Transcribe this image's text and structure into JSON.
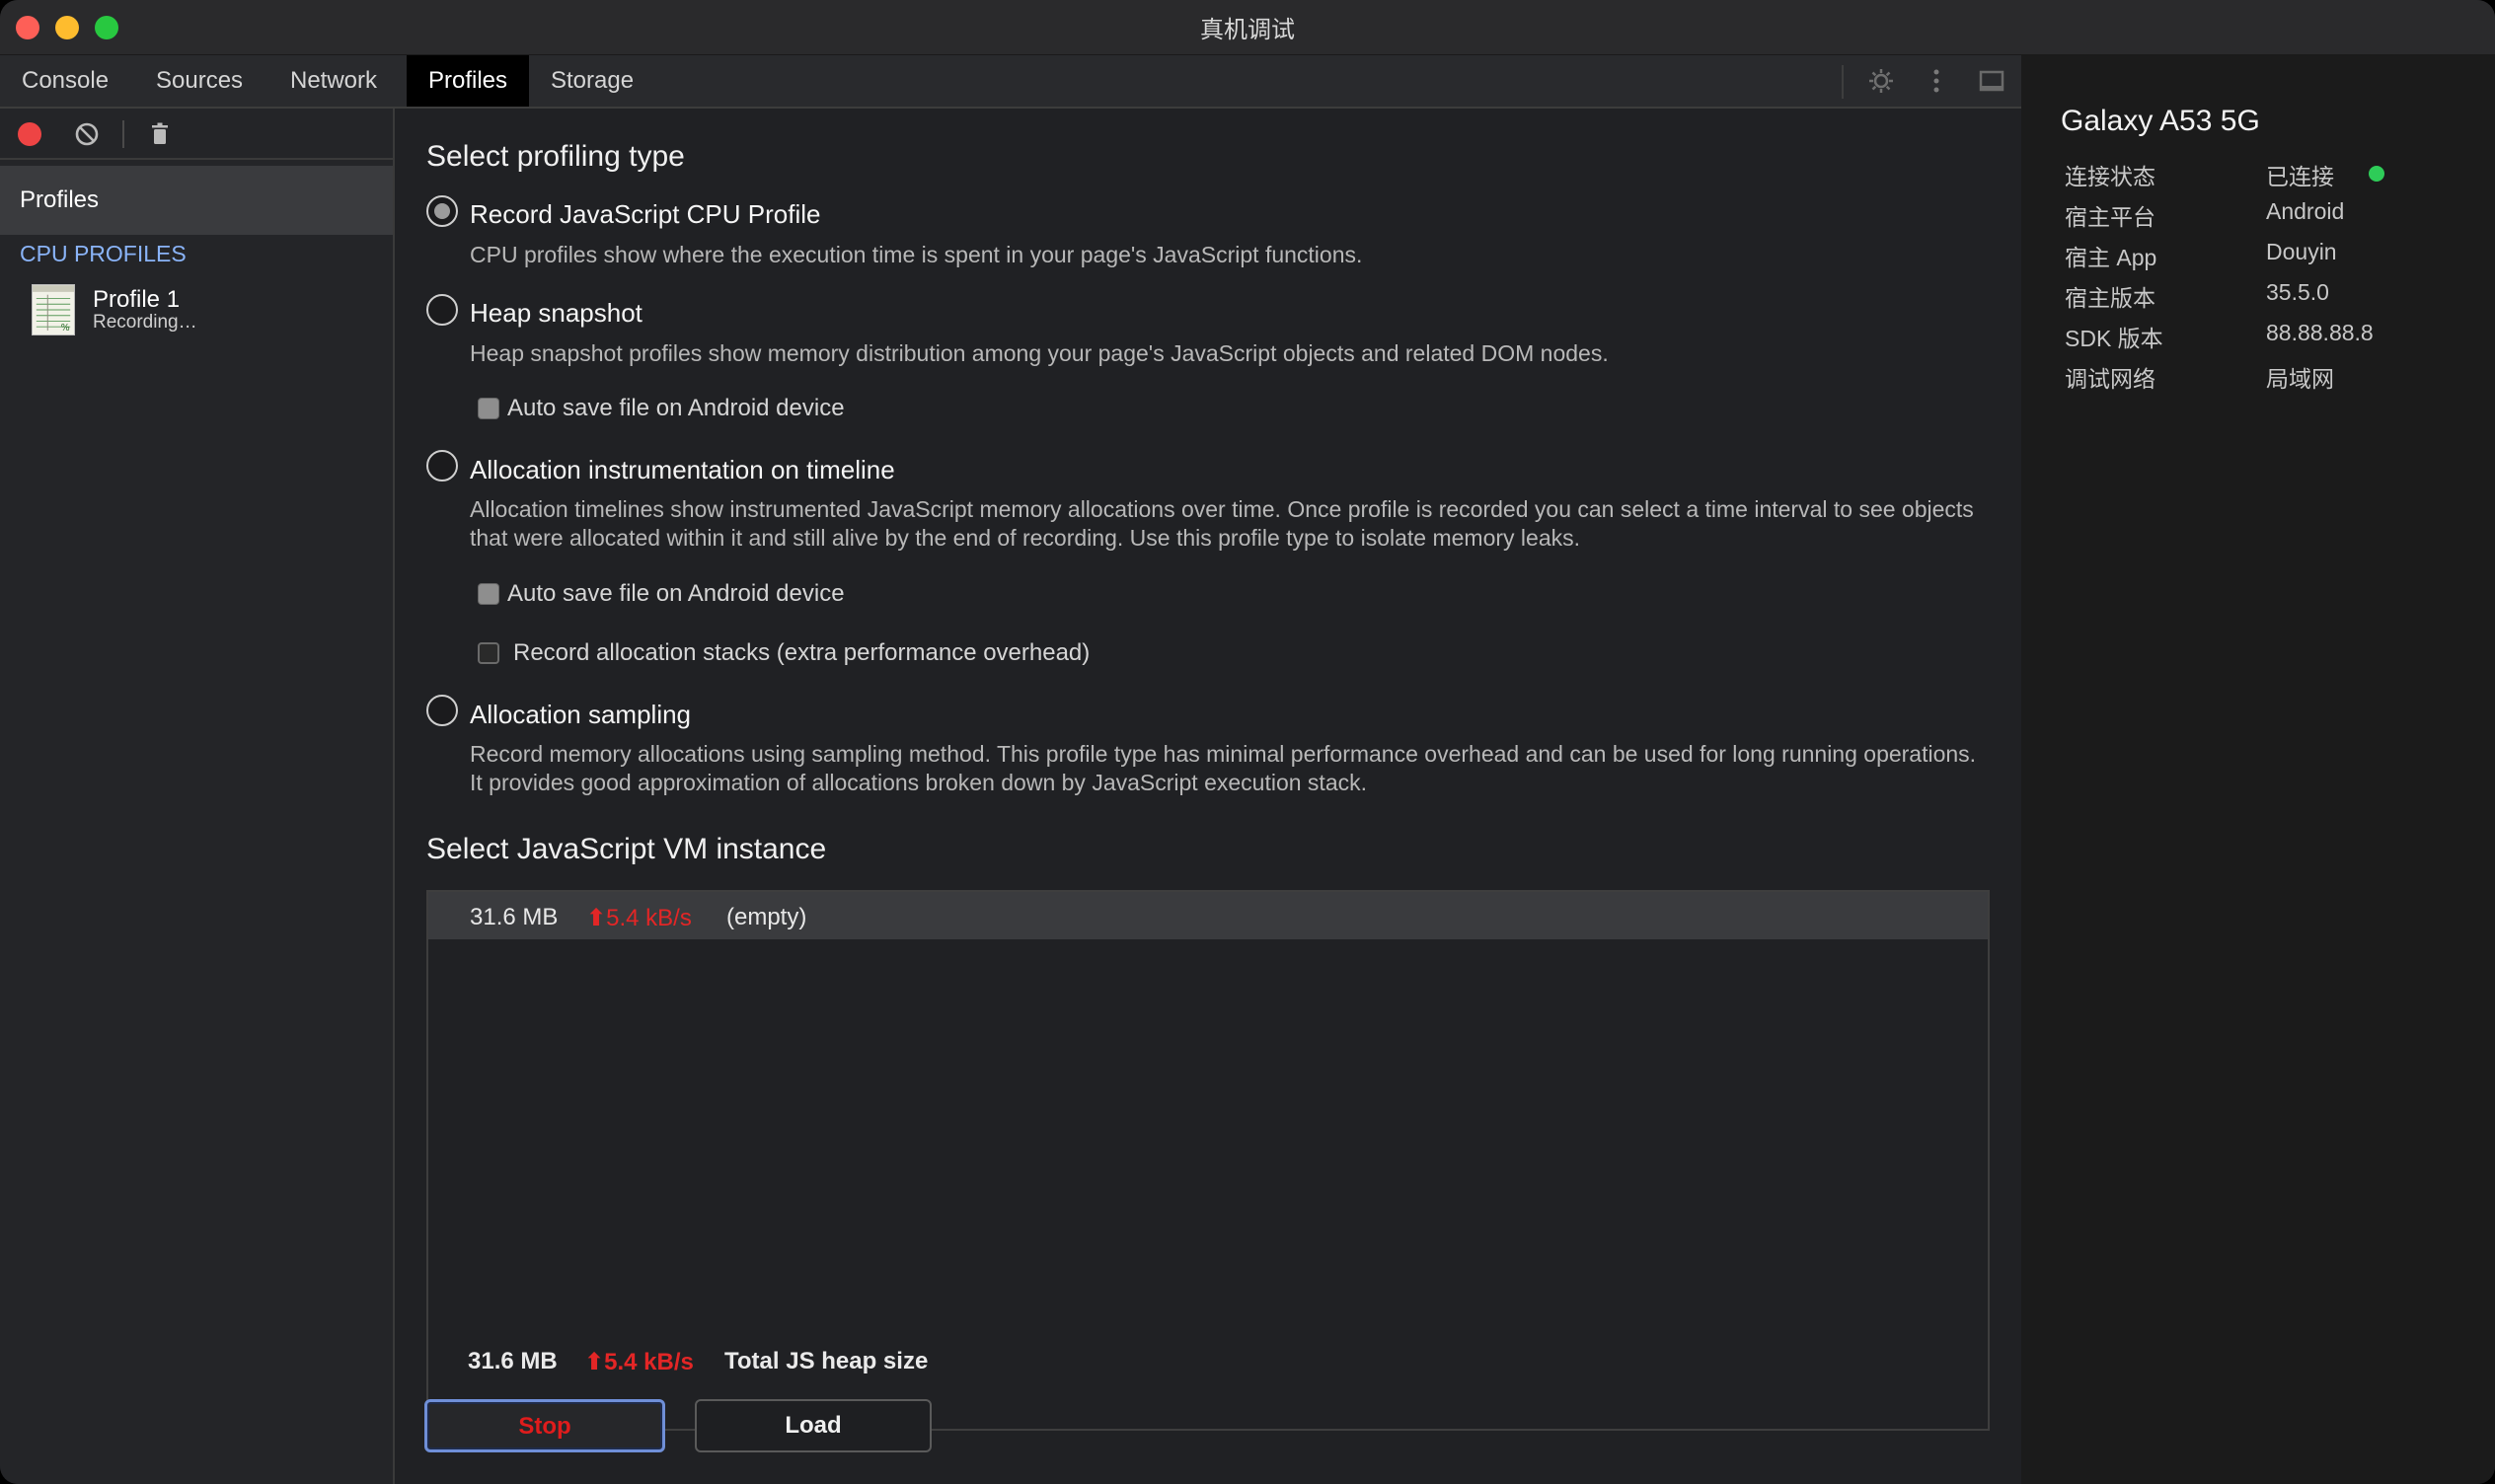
{
  "window": {
    "title": "真机调试"
  },
  "tabs": [
    {
      "label": "Console"
    },
    {
      "label": "Sources"
    },
    {
      "label": "Network"
    },
    {
      "label": "Profiles",
      "active": true
    },
    {
      "label": "Storage"
    }
  ],
  "sidebar": {
    "section_label": "Profiles",
    "group_label": "CPU PROFILES",
    "profiles": [
      {
        "name": "Profile 1",
        "status": "Recording…"
      }
    ]
  },
  "profiling": {
    "title": "Select profiling type",
    "options": [
      {
        "label": "Record JavaScript CPU Profile",
        "description": "CPU profiles show where the execution time is spent in your page's JavaScript functions.",
        "checked": true
      },
      {
        "label": "Heap snapshot",
        "description": "Heap snapshot profiles show memory distribution among your page's JavaScript objects and related DOM nodes.",
        "checkboxes": [
          {
            "label": "Auto save file on Android device",
            "checked": false
          }
        ]
      },
      {
        "label": "Allocation instrumentation on timeline",
        "description": "Allocation timelines show instrumented JavaScript memory allocations over time. Once profile is recorded you can select a time interval to see objects that were allocated within it and still alive by the end of recording. Use this profile type to isolate memory leaks.",
        "checkboxes": [
          {
            "label": "Auto save file on Android device",
            "checked": false
          },
          {
            "label": "Record allocation stacks (extra performance overhead)",
            "checked": false
          }
        ]
      },
      {
        "label": "Allocation sampling",
        "description": "Record memory allocations using sampling method. This profile type has minimal performance overhead and can be used for long running operations. It provides good approximation of allocations broken down by JavaScript execution stack."
      }
    ]
  },
  "vm": {
    "title": "Select JavaScript VM instance",
    "instances": [
      {
        "size": "31.6 MB",
        "rate": "5.4 kB/s",
        "name": "(empty)"
      }
    ],
    "total_size": "31.6 MB",
    "total_rate": "5.4 kB/s",
    "total_label": "Total JS heap size"
  },
  "buttons": {
    "stop": "Stop",
    "load": "Load"
  },
  "device": {
    "name": "Galaxy A53 5G",
    "info": [
      {
        "key": "连接状态",
        "value": "已连接"
      },
      {
        "key": "宿主平台",
        "value": "Android"
      },
      {
        "key": "宿主 App",
        "value": "Douyin"
      },
      {
        "key": "宿主版本",
        "value": "35.5.0"
      },
      {
        "key": "SDK 版本",
        "value": "88.88.88.8"
      },
      {
        "key": "调试网络",
        "value": "局域网"
      }
    ]
  },
  "colors": {
    "accent_red": "#e32626",
    "connected_green": "#2ecc58",
    "link_blue": "#8ab4f8"
  },
  "icons": {
    "record": "record-icon",
    "clear": "clear-icon",
    "trash": "trash-icon",
    "settings": "gear-icon",
    "more": "more-vertical-icon",
    "dock": "dock-icon"
  }
}
